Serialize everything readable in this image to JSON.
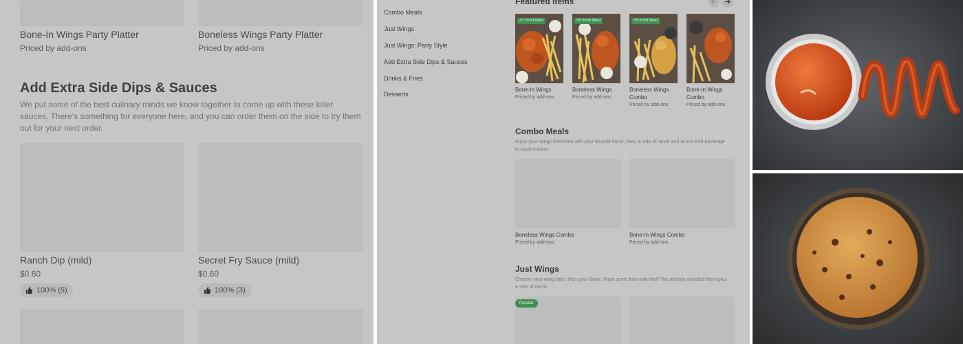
{
  "left_panel": {
    "top_items": [
      {
        "name": "Bone-In Wings Party Platter",
        "price": "Priced by add-ons"
      },
      {
        "name": "Boneless Wings Party Platter",
        "price": "Priced by add-ons"
      }
    ],
    "section_title": "Add Extra Side Dips & Sauces",
    "section_description": "We put some of the best culinary minds we know together to come up with these killer sauces. There's something for everyone here, and you can order them on the side to try them out for your next order.",
    "items": [
      {
        "name": "Ranch Dip (mild)",
        "price": "$0.60",
        "rating": "100% (5)"
      },
      {
        "name": "Secret Fry Sauce (mild)",
        "price": "$0.60",
        "rating": "100% (3)"
      }
    ]
  },
  "middle_panel": {
    "nav": [
      "Combo Meals",
      "Just Wings",
      "Just Wings: Party Style",
      "Add Extra Side Dips & Sauces",
      "Drinks & Fries",
      "Desserts"
    ],
    "featured_title": "Featured items",
    "featured": [
      {
        "badge": "#1 most liked",
        "name": "Bone-In Wings",
        "price": "Priced by add-ons"
      },
      {
        "badge": "#2 most liked",
        "name": "Boneless Wings",
        "price": "Priced by add-ons"
      },
      {
        "badge": "#3 most liked",
        "name": "Boneless Wings Combo",
        "price": "Priced by add-ons"
      },
      {
        "badge": "",
        "name": "Bone-In Wings Combo",
        "price": "Priced by add-ons"
      }
    ],
    "combo_title": "Combo Meals",
    "combo_description": "Enjoy your wings drenched with your favorite flavor, fries, a side of ranch and an ice cold beverage to wash it down.",
    "combos": [
      {
        "name": "Boneless Wings Combo",
        "price": "Priced by add-ons"
      },
      {
        "name": "Bone-In Wings Combo",
        "price": "Priced by add-ons"
      }
    ],
    "just_wings_title": "Just Wings",
    "just_wings_description": "Choose your wing style, then your flavor. Want some fries with that? We already included them plus a side of ranch.",
    "popular_badge": "Popular"
  },
  "colors": {
    "overlay_gray": "#c6c6c6",
    "placeholder_gray": "#bdbdbd",
    "badge_green": "#3f8f52",
    "sauce_orange": "#d84a1b"
  }
}
